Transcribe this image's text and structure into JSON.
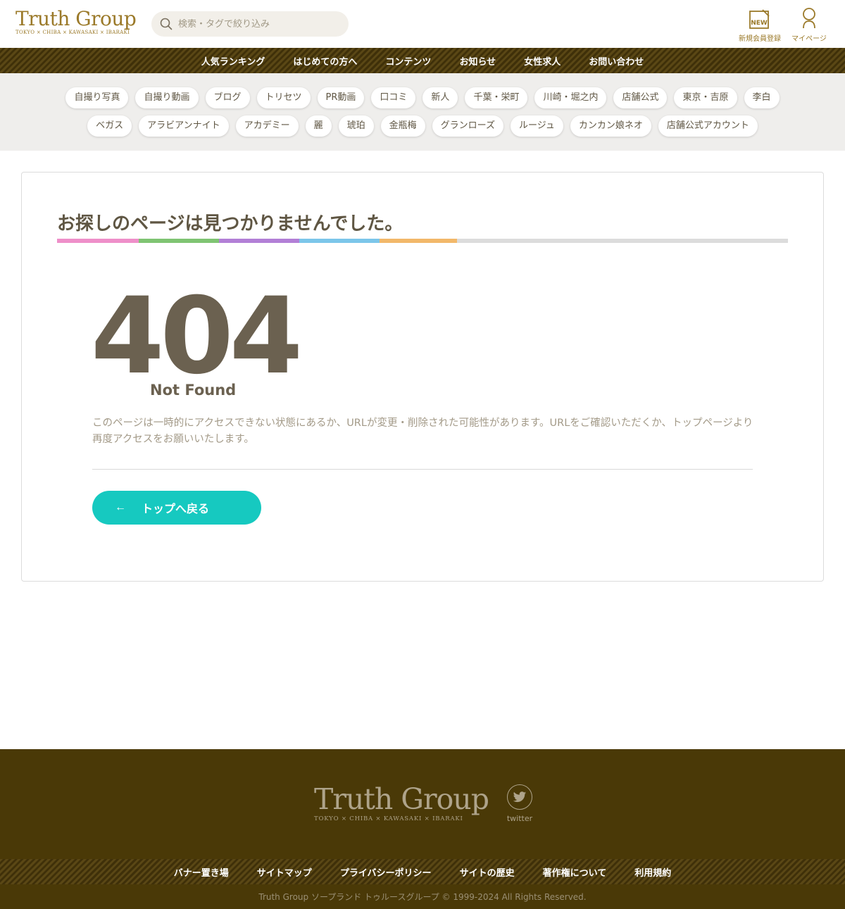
{
  "header": {
    "logo_main": "Truth Group",
    "logo_sub": "TOKYO × CHIBA × KAWASAKI × IBARAKI",
    "search_placeholder": "検索・タグで絞り込み",
    "register_label": "新規会員登録",
    "register_icon_text": "NEW",
    "mypage_label": "マイページ"
  },
  "main_nav": [
    "人気ランキング",
    "はじめての方へ",
    "コンテンツ",
    "お知らせ",
    "女性求人",
    "お問い合わせ"
  ],
  "tags_row1": [
    "自撮り写真",
    "自撮り動画",
    "ブログ",
    "トリセツ",
    "PR動画",
    "口コミ",
    "新人",
    "千葉・栄町",
    "川崎・堀之内",
    "店舗公式",
    "東京・吉原",
    "李白"
  ],
  "tags_row2": [
    "ベガス",
    "アラビアンナイト",
    "アカデミー",
    "麗",
    "琥珀",
    "金瓶梅",
    "グランローズ",
    "ルージュ",
    "カンカン娘ネオ",
    "店舗公式アカウント"
  ],
  "content": {
    "title": "お探しのページは見つかりませんでした。",
    "title_bar_colors": [
      "#ee8fc9",
      "#7fc473",
      "#b27fd6",
      "#7cc6ea",
      "#f2b86a"
    ],
    "code": "404",
    "code_label": "Not Found",
    "description": "このページは一時的にアクセスできない状態にあるか、URLが変更・削除された可能性があります。URLをご確認いただくか、トップページより再度アクセスをお願いいたします。",
    "back_button": "トップへ戻る",
    "back_arrow": "←"
  },
  "footer": {
    "logo_main": "Truth Group",
    "logo_sub": "TOKYO × CHIBA × KAWASAKI × IBARAKI",
    "twitter_label": "twitter",
    "nav": [
      "バナー置き場",
      "サイトマップ",
      "プライバシーポリシー",
      "サイトの歴史",
      "著作権について",
      "利用規約"
    ],
    "copyright": "Truth Group ソープランド トゥルースグループ © 1999-2024 All Rights Reserved."
  },
  "colors": {
    "brand_gold": "#9b7a2a",
    "nav_brown": "#4a3907",
    "accent_teal": "#16c9c0"
  }
}
